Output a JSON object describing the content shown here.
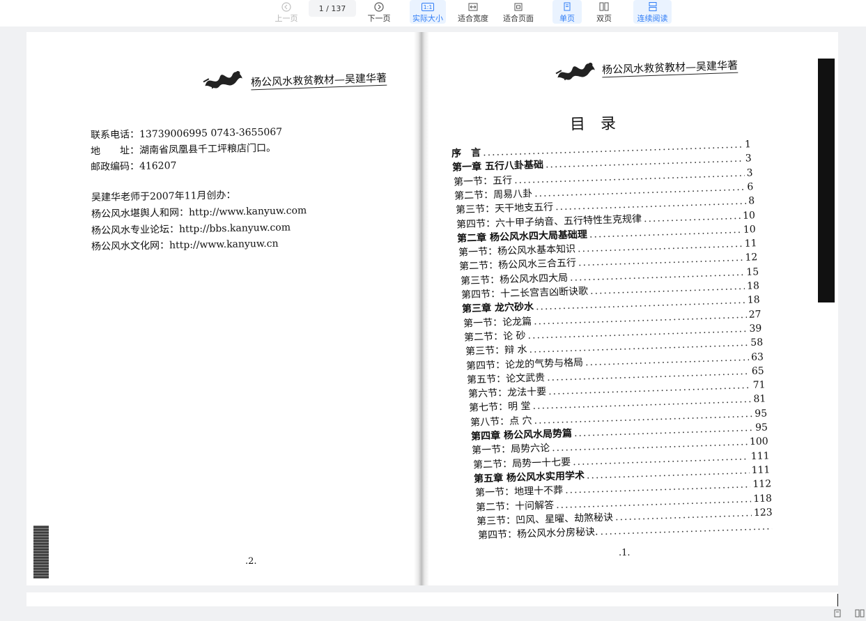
{
  "toolbar": {
    "prev_label": "上一页",
    "next_label": "下一页",
    "page_indicator": "1 / 137",
    "actual_size_label": "实际大小",
    "actual_size_icon_text": "1:1",
    "fit_width_label": "适合宽度",
    "fit_page_label": "适合页面",
    "single_page_label": "单页",
    "double_page_label": "双页",
    "continuous_label": "连续阅读",
    "accent_color": "#2f7cf6"
  },
  "left_page": {
    "header_logo": "",
    "header_title": "杨公风水救贫教材—吴建华著",
    "contact_lines": [
      "联系电话：13739006995   0743-3655067",
      "地　　址：湖南省凤凰县千工坪粮店门口。",
      "邮政编码：416207"
    ],
    "info_lines": [
      "吴建华老师于2007年11月创办：",
      "杨公风水堪舆人和网：http://www.kanyuw.com",
      "杨公风水专业论坛：http://bbs.kanyuw.com",
      "杨公风水文化网：http://www.kanyuw.cn"
    ],
    "page_number": ".2."
  },
  "right_page": {
    "header_title": "杨公风水救贫教材—吴建华著",
    "toc_title": "目　录",
    "toc": [
      {
        "label": "序　言",
        "page": "1",
        "bold": true
      },
      {
        "label": "第一章 五行八卦基础",
        "page": "3",
        "bold": true
      },
      {
        "label": "第一节：五行",
        "page": "3",
        "bold": false
      },
      {
        "label": "第二节：周易八卦",
        "page": "6",
        "bold": false
      },
      {
        "label": "第三节：天干地支五行",
        "page": "8",
        "bold": false
      },
      {
        "label": "第四节：六十甲子纳音、五行特性生克规律",
        "page": "10",
        "bold": false
      },
      {
        "label": "第二章 杨公风水四大局基础理",
        "page": "10",
        "bold": true
      },
      {
        "label": "第一节：杨公风水基本知识",
        "page": "11",
        "bold": false
      },
      {
        "label": "第二节：杨公风水三合五行",
        "page": "12",
        "bold": false
      },
      {
        "label": "第三节：杨公风水四大局",
        "page": "15",
        "bold": false
      },
      {
        "label": "第四节：十二长宫吉凶断诀歌",
        "page": "18",
        "bold": false
      },
      {
        "label": "第三章 龙穴砂水",
        "page": "18",
        "bold": true
      },
      {
        "label": "第一节：论龙篇",
        "page": "27",
        "bold": false
      },
      {
        "label": "第二节：论 砂",
        "page": "39",
        "bold": false
      },
      {
        "label": "第三节：辩 水",
        "page": "58",
        "bold": false
      },
      {
        "label": "第四节：论龙的气势与格局",
        "page": "63",
        "bold": false
      },
      {
        "label": "第五节：论文武贵",
        "page": "65",
        "bold": false
      },
      {
        "label": "第六节：龙法十要",
        "page": "71",
        "bold": false
      },
      {
        "label": "第七节：明 堂",
        "page": "81",
        "bold": false
      },
      {
        "label": "第八节：点 穴",
        "page": "95",
        "bold": false
      },
      {
        "label": "第四章 杨公风水局势篇",
        "page": "95",
        "bold": true
      },
      {
        "label": "第一节：局势六论",
        "page": "100",
        "bold": false
      },
      {
        "label": "第二节：局势一十七要",
        "page": "111",
        "bold": false
      },
      {
        "label": "第五章 杨公风水实用学术",
        "page": "111",
        "bold": true
      },
      {
        "label": "第一节：地理十不葬",
        "page": "112",
        "bold": false
      },
      {
        "label": "第二节：十问解答",
        "page": "118",
        "bold": false
      },
      {
        "label": "第三节：凹风、星曜、劫煞秘诀",
        "page": "123",
        "bold": false
      },
      {
        "label": "第四节：杨公风水分房秘诀.",
        "page": "",
        "bold": false
      }
    ],
    "page_number": ".1."
  }
}
